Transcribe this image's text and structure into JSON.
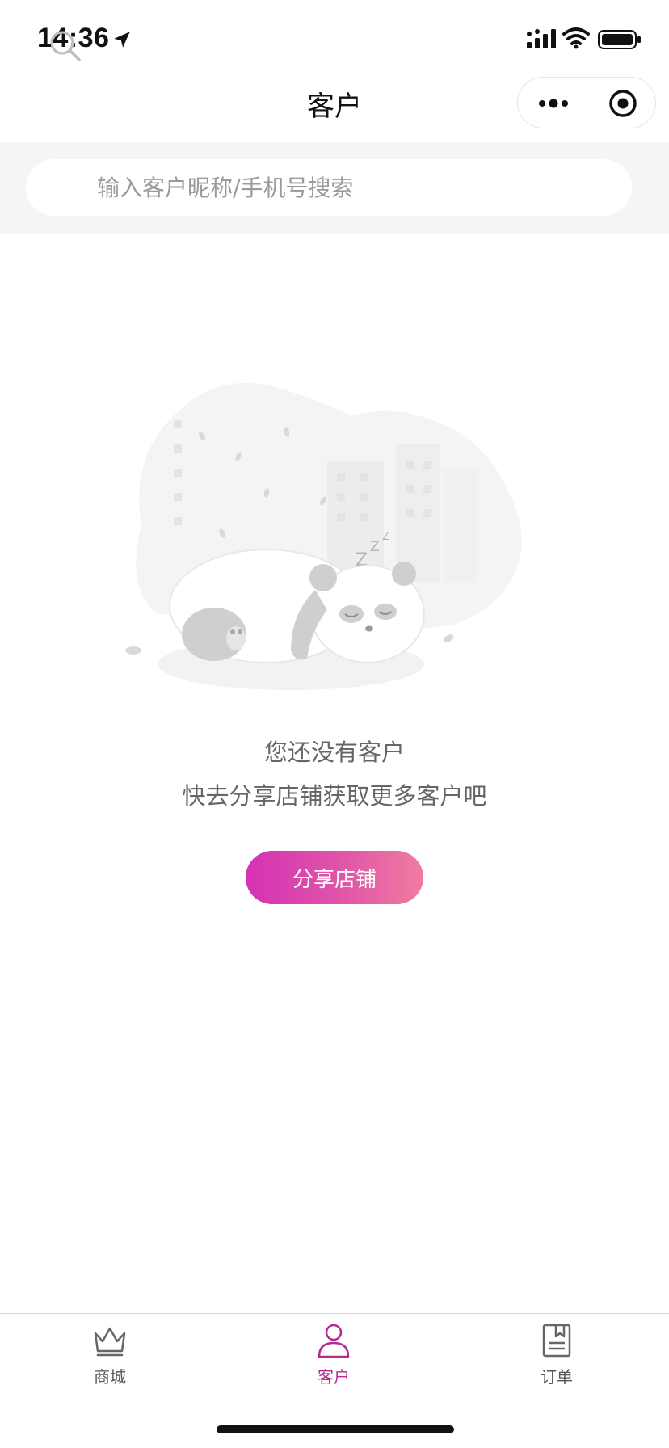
{
  "status_bar": {
    "time": "14:36"
  },
  "nav": {
    "title": "客户"
  },
  "search": {
    "placeholder": "输入客户昵称/手机号搜索",
    "value": ""
  },
  "empty_state": {
    "line1": "您还没有客户",
    "line2": "快去分享店铺获取更多客户吧",
    "button_label": "分享店铺"
  },
  "tabs": [
    {
      "label": "商城",
      "icon": "crown-icon",
      "active": false
    },
    {
      "label": "客户",
      "icon": "person-icon",
      "active": true
    },
    {
      "label": "订单",
      "icon": "document-icon",
      "active": false
    }
  ],
  "colors": {
    "accent": "#b42a92",
    "button_gradient_start": "#d531b5",
    "button_gradient_end": "#f07ca0",
    "search_band": "#f5f5f7"
  }
}
